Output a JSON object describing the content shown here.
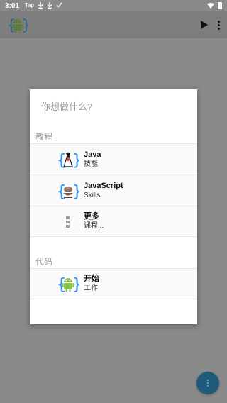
{
  "status_bar": {
    "time": "3:01",
    "icons": [
      "tap-icon",
      "download-icon",
      "download-icon",
      "check-icon"
    ],
    "tap_label": "Tap"
  },
  "app_bar": {
    "logo": "android-logo-icon",
    "actions": [
      "play-icon",
      "more-vertical-icon"
    ]
  },
  "dialog": {
    "title": "你想做什么?",
    "sections": [
      {
        "header": "教程",
        "items": [
          {
            "icon": "java-icon",
            "title": "Java",
            "subtitle": "技能"
          },
          {
            "icon": "javascript-icon",
            "title": "JavaScript",
            "subtitle": "Skills"
          },
          {
            "icon": "more-vertical-icon",
            "title": "更多",
            "subtitle": "课程..."
          }
        ]
      },
      {
        "header": "代码",
        "items": [
          {
            "icon": "android-icon",
            "title": "开始",
            "subtitle": "工作"
          }
        ]
      }
    ]
  },
  "colors": {
    "scrim": "#8a8a8a",
    "fab": "#1e5a7a",
    "bracket": "#1e90ff",
    "android_green": "#8bc34a"
  }
}
